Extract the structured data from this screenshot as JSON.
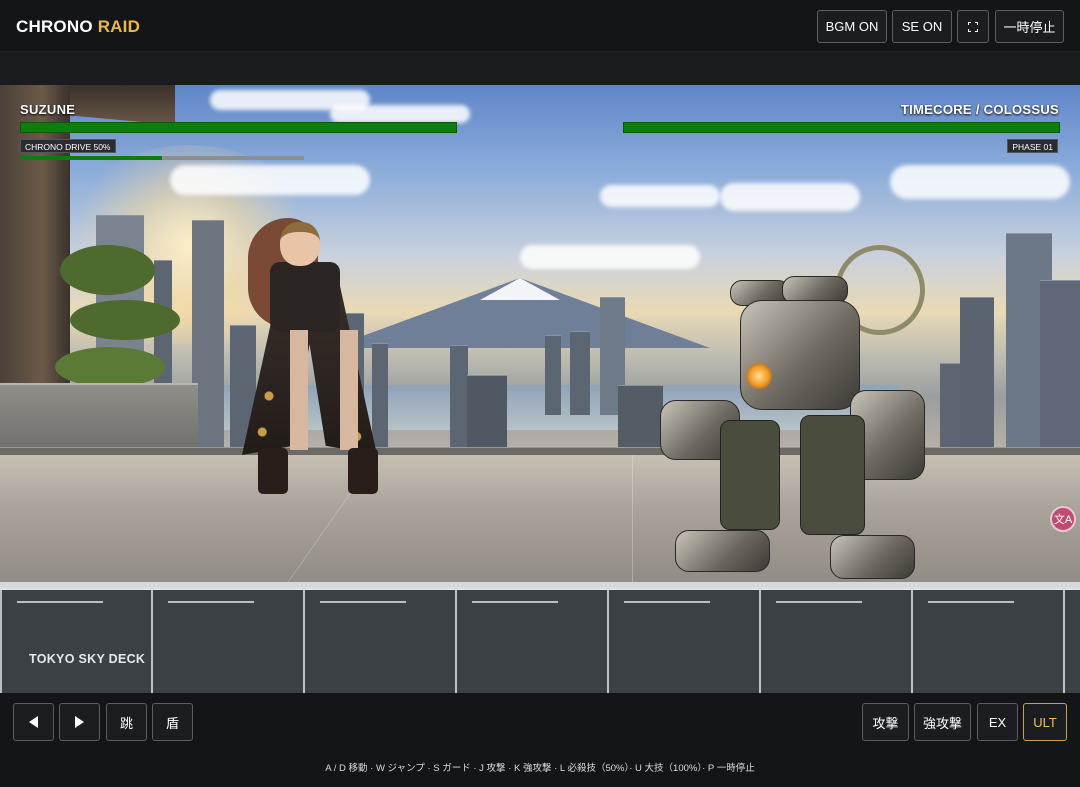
{
  "app": {
    "title_main": "CHRONO",
    "title_accent": "RAID",
    "accent_color": "#e8b84e"
  },
  "top_controls": {
    "bgm": "BGM ON",
    "se": "SE ON",
    "fullscreen_icon": "fullscreen-icon",
    "pause": "一時停止"
  },
  "player": {
    "name": "SUZUNE",
    "hp": 1.0,
    "drive_label": "CHRONO DRIVE 50%",
    "drive": 0.5
  },
  "enemy": {
    "name": "TIMECORE / COLOSSUS",
    "hp": 1.0,
    "phase_label": "PHASE 01"
  },
  "stage": {
    "name": "TOKYO SKY DECK"
  },
  "side_badge": {
    "icon": "translate-icon",
    "glyph": "文A"
  },
  "controls": {
    "left": {
      "icon": "arrow-left-icon"
    },
    "right": {
      "icon": "arrow-right-icon"
    },
    "jump": "跳",
    "guard": "盾",
    "attack": "攻撃",
    "heavy": "強攻撃",
    "ex": "EX",
    "ult": "ULT"
  },
  "help_text": "A / D 移動 · W ジャンプ · S ガード · J 攻撃 · K 強攻撃 · L 必殺技（50%）· U 大技（100%）· P 一時停止",
  "colors": {
    "hp": "#0d7d0d",
    "ult_border": "#c4a24a",
    "background": "#141518"
  }
}
